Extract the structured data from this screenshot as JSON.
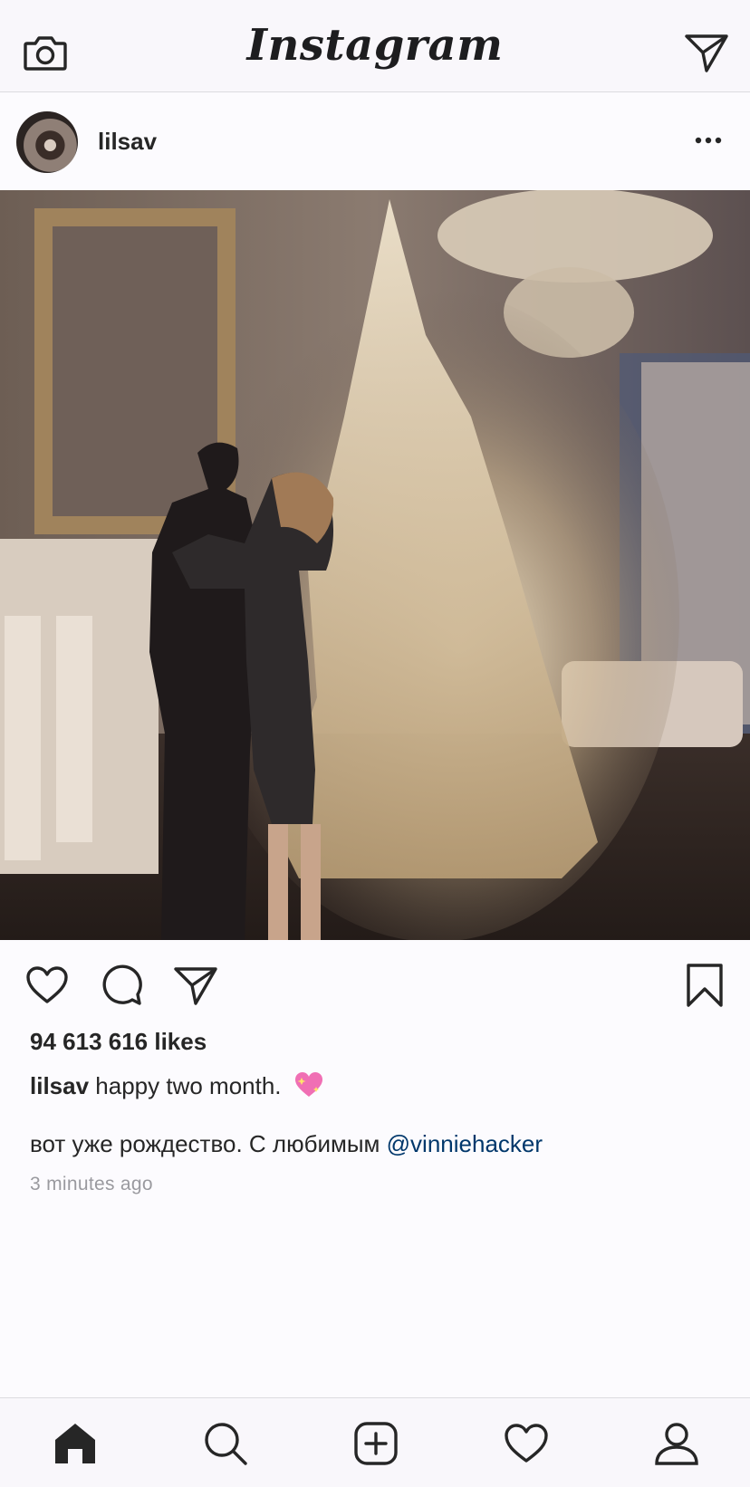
{
  "header": {
    "logo_text": "Instagram",
    "camera_icon": "camera-icon",
    "direct_icon": "paper-plane-icon"
  },
  "post": {
    "username": "lilsav",
    "more_icon": "more-dots-icon",
    "image_description_icon": "photo",
    "likes_text": "94 613 616 likes",
    "caption_user": "lilsav",
    "caption_text": "happy two month.",
    "caption_emoji": "sparkling-heart-emoji",
    "caption_line2_text": "вот уже рождество. С любимым",
    "caption_mention": "@vinniehacker",
    "timestamp": "3 minutes ago"
  },
  "actions": {
    "like_icon": "heart-icon",
    "comment_icon": "comment-icon",
    "share_icon": "paper-plane-icon",
    "save_icon": "bookmark-icon"
  },
  "nav": {
    "items": [
      "home-icon",
      "search-icon",
      "add-post-icon",
      "heart-icon",
      "profile-icon"
    ]
  },
  "colors": {
    "text": "#262626",
    "link": "#00376b",
    "muted": "#9a9a9f",
    "bar_bg": "#f9f7fb",
    "divider": "#dcdbe0"
  }
}
